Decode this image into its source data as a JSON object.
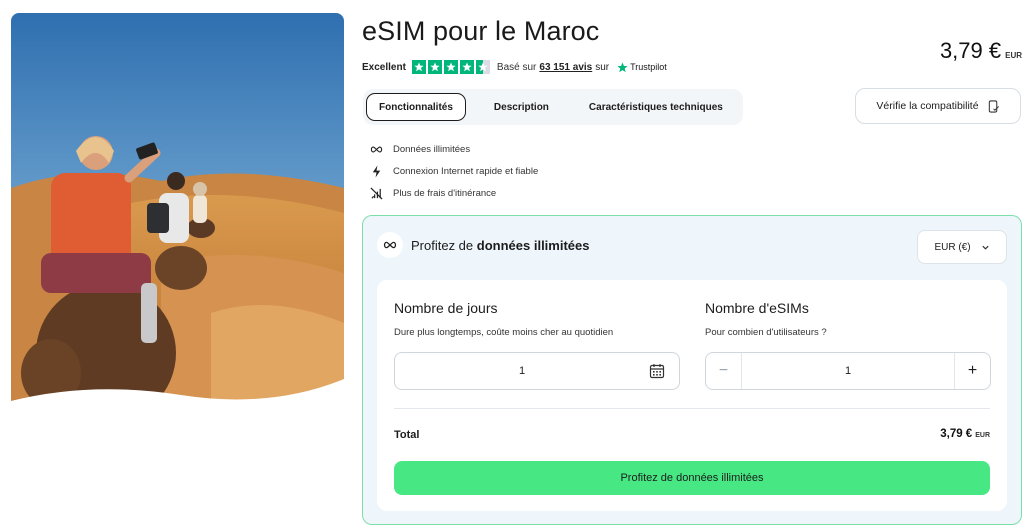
{
  "product": {
    "title": "eSIM pour le Maroc",
    "price": "3,79 €",
    "price_currency": "EUR"
  },
  "rating": {
    "label": "Excellent",
    "stars": 4.5,
    "based_on": "Basé sur",
    "count": "63 151 avis",
    "on": "sur",
    "provider": "Trustpilot",
    "star_color": "#00b67a"
  },
  "tabs": [
    {
      "label": "Fonctionnalités",
      "active": true
    },
    {
      "label": "Description",
      "active": false
    },
    {
      "label": "Caractéristiques techniques",
      "active": false
    }
  ],
  "compat_button": {
    "label": "Vérifie la compatibilité",
    "icon": "phone-check-icon"
  },
  "features": [
    {
      "icon": "infinity-icon",
      "label": "Données illimitées"
    },
    {
      "icon": "lightning-icon",
      "label": "Connexion Internet rapide et fiable"
    },
    {
      "icon": "no-roaming-icon",
      "label": "Plus de frais d'itinérance"
    }
  ],
  "offer": {
    "title_prefix": "Profitez de",
    "title_bold": "données illimitées",
    "currency_select": "EUR (€)",
    "days": {
      "title": "Nombre de jours",
      "subtitle": "Dure plus longtemps, coûte moins cher au quotidien",
      "value": "1"
    },
    "esims": {
      "title": "Nombre d'eSIMs",
      "subtitle": "Pour combien d'utilisateurs ?",
      "value": "1",
      "minus": "−",
      "plus": "+"
    },
    "total_label": "Total",
    "total_value": "3,79 €",
    "total_currency": "EUR",
    "cta": "Profitez de données illimitées",
    "accent": "#47e883",
    "panel_bg": "#eef6fb"
  }
}
